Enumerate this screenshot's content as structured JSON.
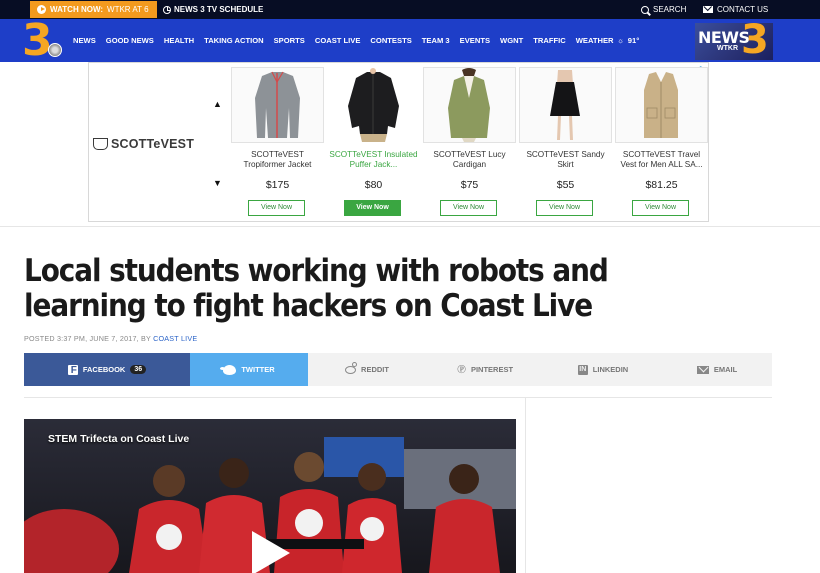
{
  "topbar": {
    "watch_now_label": "WATCH NOW:",
    "watch_now_station": "WTKR AT 6",
    "tv_schedule": "NEWS 3 TV SCHEDULE",
    "search": "SEARCH",
    "contact": "CONTACT US"
  },
  "logo": {
    "text": "3"
  },
  "nav": {
    "items": [
      "NEWS",
      "GOOD NEWS",
      "HEALTH",
      "TAKING ACTION",
      "SPORTS",
      "COAST LIVE",
      "CONTESTS",
      "TEAM 3",
      "EVENTS",
      "WGNT",
      "TRAFFIC"
    ],
    "weather_label": "WEATHER",
    "weather_temp": "91°"
  },
  "news3_badge": {
    "word": "NEWS",
    "numeral": "3",
    "callsign": "WTKR"
  },
  "ad": {
    "brand": "SCOTTeVEST",
    "arrow_up": "▲",
    "arrow_down": "▼",
    "adchoices": "▷",
    "products": [
      {
        "name": "SCOTTeVEST Tropiformer Jacket",
        "price": "$175",
        "button": "View Now"
      },
      {
        "name": "SCOTTeVEST Insulated Puffer Jack...",
        "price": "$80",
        "button": "View Now"
      },
      {
        "name": "SCOTTeVEST Lucy Cardigan",
        "price": "$75",
        "button": "View Now"
      },
      {
        "name": "SCOTTeVEST Sandy Skirt",
        "price": "$55",
        "button": "View Now"
      },
      {
        "name": "SCOTTeVEST Travel Vest for Men ALL SA...",
        "price": "$81.25",
        "button": "View Now"
      }
    ]
  },
  "article": {
    "headline": "Local students working with robots and learning to fight hackers on Coast Live",
    "byline_prefix": "POSTED 3:37 PM, JUNE 7, 2017, BY",
    "author": "COAST LIVE"
  },
  "share": {
    "facebook": "FACEBOOK",
    "facebook_count": "36",
    "twitter": "TWITTER",
    "reddit": "REDDIT",
    "pinterest": "PINTEREST",
    "linkedin": "LINKEDIN",
    "email": "EMAIL"
  },
  "video": {
    "title": "STEM Trifecta on Coast Live"
  },
  "colors": {
    "topbar": "#070d24",
    "nav": "#1e3ec8",
    "accent_orange": "#f39a1e",
    "facebook": "#3b5998",
    "twitter": "#55acee",
    "ad_green": "#3aa641",
    "link_blue": "#2d65c8"
  },
  "icons": [
    "play-icon",
    "clock-icon",
    "search-icon",
    "mail-icon",
    "weather-icon",
    "shield-icon",
    "adchoices-icon",
    "facebook-icon",
    "twitter-icon",
    "reddit-icon",
    "pinterest-icon",
    "linkedin-icon",
    "email-icon",
    "video-play-icon"
  ]
}
